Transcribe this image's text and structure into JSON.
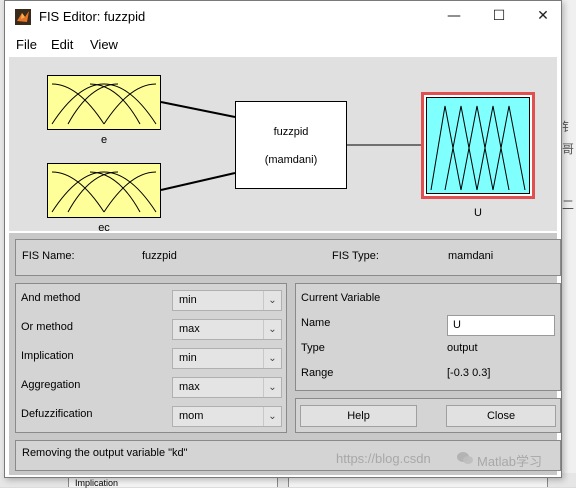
{
  "background": {
    "right_glyphs": [
      "钅",
      "哥",
      "二"
    ],
    "bottom_field": "Implication"
  },
  "window": {
    "title": "FIS Editor: fuzzpid",
    "minimize": "—",
    "maximize": "☐",
    "close": "✕"
  },
  "menu": {
    "file": "File",
    "edit": "Edit",
    "view": "View"
  },
  "diagram": {
    "inputs": [
      {
        "name": "e"
      },
      {
        "name": "ec"
      }
    ],
    "system_name": "fuzzpid",
    "system_type": "(mamdani)",
    "output": {
      "name": "U"
    }
  },
  "info": {
    "fis_name_label": "FIS Name:",
    "fis_name_value": "fuzzpid",
    "fis_type_label": "FIS Type:",
    "fis_type_value": "mamdani"
  },
  "methods": {
    "and_label": "And method",
    "and_value": "min",
    "or_label": "Or method",
    "or_value": "max",
    "implication_label": "Implication",
    "implication_value": "min",
    "aggregation_label": "Aggregation",
    "aggregation_value": "max",
    "defuzz_label": "Defuzzification",
    "defuzz_value": "mom"
  },
  "current_variable": {
    "title": "Current Variable",
    "name_label": "Name",
    "name_value": "U",
    "type_label": "Type",
    "type_value": "output",
    "range_label": "Range",
    "range_value": "[-0.3 0.3]"
  },
  "buttons": {
    "help": "Help",
    "close": "Close"
  },
  "status": "Removing the output variable \"kd\"",
  "watermark": {
    "url": "https://blog.csdn",
    "brand": "Matlab学习"
  },
  "colors": {
    "input_mf_fill": "#ffff99",
    "output_mf_fill": "#80ffff",
    "selected_border": "#e05050",
    "panel_bg": "#d4d4d4"
  }
}
